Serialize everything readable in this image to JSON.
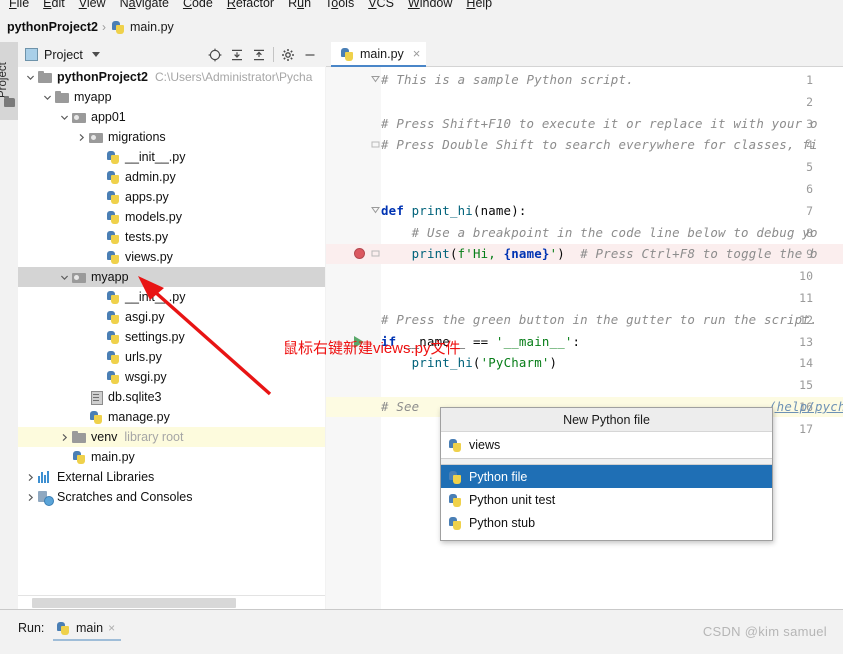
{
  "menubar": {
    "items": [
      "File",
      "Edit",
      "View",
      "Navigate",
      "Code",
      "Refactor",
      "Run",
      "Tools",
      "VCS",
      "Window",
      "Help"
    ]
  },
  "breadcrumb": {
    "project": "pythonProject2",
    "separator": "›",
    "file": "main.py",
    "file_icon": "python-file-icon"
  },
  "left_strip": {
    "tab_label": "Project",
    "icon": "folder-icon"
  },
  "project_panel": {
    "title": "Project",
    "title_icon": "project-window-icon",
    "chevron_icon": "chevron-down-icon",
    "toolbar": [
      {
        "name": "locate-icon",
        "glyph": "⊕"
      },
      {
        "name": "expand-all-icon",
        "glyph": "⤓"
      },
      {
        "name": "collapse-all-icon",
        "glyph": "⤒"
      },
      {
        "name": "settings-gear-icon",
        "glyph": "⚙"
      },
      {
        "name": "hide-window-icon",
        "glyph": "—"
      }
    ],
    "tree": [
      {
        "label": "pythonProject2",
        "bold": true,
        "indent": 0,
        "twist": "down",
        "icon": "folder-icon",
        "suffix": "C:\\Users\\Administrator\\Pycha",
        "suffix_kind": "path"
      },
      {
        "label": "myapp",
        "bold": false,
        "indent": 1,
        "twist": "down",
        "icon": "folder-icon"
      },
      {
        "label": "app01",
        "bold": false,
        "indent": 2,
        "twist": "down",
        "icon": "package-icon"
      },
      {
        "label": "migrations",
        "bold": false,
        "indent": 3,
        "twist": "right",
        "icon": "package-icon"
      },
      {
        "label": "__init__.py",
        "bold": false,
        "indent": 4,
        "twist": "none",
        "icon": "python-file-icon"
      },
      {
        "label": "admin.py",
        "bold": false,
        "indent": 4,
        "twist": "none",
        "icon": "python-file-icon"
      },
      {
        "label": "apps.py",
        "bold": false,
        "indent": 4,
        "twist": "none",
        "icon": "python-file-icon"
      },
      {
        "label": "models.py",
        "bold": false,
        "indent": 4,
        "twist": "none",
        "icon": "python-file-icon"
      },
      {
        "label": "tests.py",
        "bold": false,
        "indent": 4,
        "twist": "none",
        "icon": "python-file-icon"
      },
      {
        "label": "views.py",
        "bold": false,
        "indent": 4,
        "twist": "none",
        "icon": "python-file-icon"
      },
      {
        "label": "myapp",
        "bold": false,
        "indent": 2,
        "twist": "down",
        "icon": "package-icon",
        "selected": true
      },
      {
        "label": "__init__.py",
        "bold": false,
        "indent": 4,
        "twist": "none",
        "icon": "python-file-icon"
      },
      {
        "label": "asgi.py",
        "bold": false,
        "indent": 4,
        "twist": "none",
        "icon": "python-file-icon"
      },
      {
        "label": "settings.py",
        "bold": false,
        "indent": 4,
        "twist": "none",
        "icon": "python-file-icon"
      },
      {
        "label": "urls.py",
        "bold": false,
        "indent": 4,
        "twist": "none",
        "icon": "python-file-icon"
      },
      {
        "label": "wsgi.py",
        "bold": false,
        "indent": 4,
        "twist": "none",
        "icon": "python-file-icon"
      },
      {
        "label": "db.sqlite3",
        "bold": false,
        "indent": 3,
        "twist": "none",
        "icon": "database-icon"
      },
      {
        "label": "manage.py",
        "bold": false,
        "indent": 3,
        "twist": "none",
        "icon": "python-file-icon"
      },
      {
        "label": "venv",
        "bold": false,
        "indent": 2,
        "twist": "right",
        "icon": "folder-icon",
        "suffix": "library root",
        "suffix_kind": "libroot",
        "highlight": true
      },
      {
        "label": "main.py",
        "bold": false,
        "indent": 2,
        "twist": "none",
        "icon": "python-file-icon"
      },
      {
        "label": "External Libraries",
        "bold": false,
        "indent": 0,
        "twist": "right",
        "icon": "libraries-icon"
      },
      {
        "label": "Scratches and Consoles",
        "bold": false,
        "indent": 0,
        "twist": "right",
        "icon": "scratches-icon"
      }
    ]
  },
  "editor": {
    "tab": {
      "label": "main.py",
      "icon": "python-file-icon",
      "close_glyph": "×"
    },
    "lines": [
      {
        "n": "1",
        "fold": "open",
        "segments": [
          {
            "t": "# This is a sample Python script.",
            "c": "cm"
          }
        ]
      },
      {
        "n": "2",
        "segments": []
      },
      {
        "n": "3",
        "segments": [
          {
            "t": "# Press Shift+F10 to execute it or replace it with your o",
            "c": "cm"
          }
        ]
      },
      {
        "n": "4",
        "fold": "close",
        "segments": [
          {
            "t": "# Press Double Shift to search everywhere for classes, fi",
            "c": "cm"
          }
        ]
      },
      {
        "n": "5",
        "segments": []
      },
      {
        "n": "6",
        "segments": []
      },
      {
        "n": "7",
        "fold": "open",
        "segments": [
          {
            "t": "def ",
            "c": "kw"
          },
          {
            "t": "print_hi",
            "c": "fn"
          },
          {
            "t": "(name):",
            "c": "pl"
          }
        ]
      },
      {
        "n": "8",
        "segments": [
          {
            "t": "    # Use a breakpoint in the code line below to debug yo",
            "c": "cm"
          }
        ]
      },
      {
        "n": "9",
        "breakpoint": true,
        "fold": "close",
        "highlight": "pink",
        "segments": [
          {
            "t": "    ",
            "c": "pl"
          },
          {
            "t": "print",
            "c": "fn"
          },
          {
            "t": "(",
            "c": "pl"
          },
          {
            "t": "f'Hi, ",
            "c": "st"
          },
          {
            "t": "{name}",
            "c": "kw"
          },
          {
            "t": "'",
            "c": "st"
          },
          {
            "t": ")  ",
            "c": "pl"
          },
          {
            "t": "# Press Ctrl+F8 to toggle the b",
            "c": "cm"
          }
        ]
      },
      {
        "n": "10",
        "segments": []
      },
      {
        "n": "11",
        "segments": []
      },
      {
        "n": "12",
        "segments": [
          {
            "t": "# Press the green button in the gutter to run the script.",
            "c": "cm"
          }
        ]
      },
      {
        "n": "13",
        "run_marker": true,
        "segments": [
          {
            "t": "if ",
            "c": "kw"
          },
          {
            "t": "__name__ ",
            "c": "pl"
          },
          {
            "t": "== ",
            "c": "pl"
          },
          {
            "t": "'__main__'",
            "c": "st"
          },
          {
            "t": ":",
            "c": "pl"
          }
        ]
      },
      {
        "n": "14",
        "segments": [
          {
            "t": "    ",
            "c": "pl"
          },
          {
            "t": "print_hi",
            "c": "fn"
          },
          {
            "t": "(",
            "c": "pl"
          },
          {
            "t": "'PyCharm'",
            "c": "st"
          },
          {
            "t": ")",
            "c": "pl"
          }
        ]
      },
      {
        "n": "15",
        "segments": []
      },
      {
        "n": "16",
        "highlight": "yellow",
        "segments": [
          {
            "t": "# See ",
            "c": "cm"
          }
        ]
      },
      {
        "n": "17",
        "segments": []
      }
    ],
    "clipped_right_text": "(help/pych"
  },
  "annotation": {
    "text": "鼠标右键新建views.py文件",
    "color": "#ee1111",
    "arrow_name": "red-arrow-annotation"
  },
  "popup": {
    "title": "New Python file",
    "input_value": "views",
    "input_icon": "python-file-icon",
    "items": [
      {
        "label": "Python file",
        "icon": "python-file-icon",
        "selected": true
      },
      {
        "label": "Python unit test",
        "icon": "python-file-icon",
        "selected": false
      },
      {
        "label": "Python stub",
        "icon": "python-file-icon",
        "selected": false
      }
    ],
    "selection_color": "#1f6fb5"
  },
  "runbar": {
    "label": "Run:",
    "tab_name": "main",
    "tab_icon": "python-icon",
    "close_glyph": "×"
  },
  "watermark": "CSDN @kim samuel"
}
